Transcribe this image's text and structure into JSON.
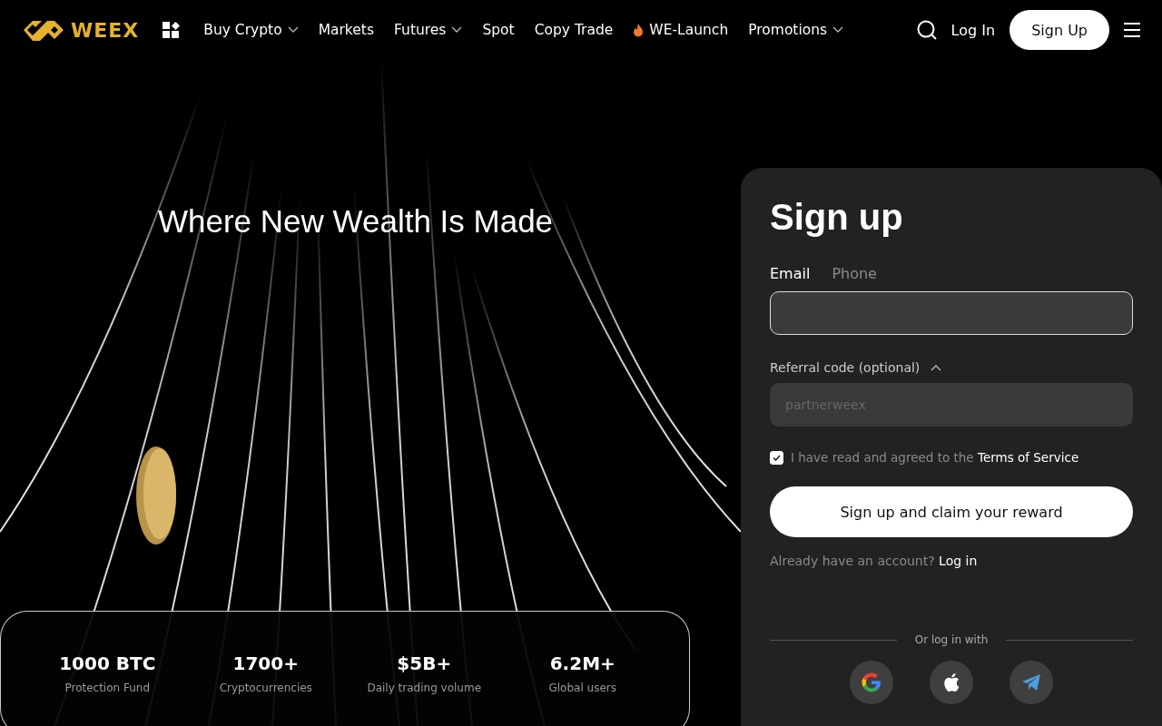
{
  "header": {
    "logo": "WEEX",
    "nav": [
      {
        "label": "Buy Crypto",
        "kind": "dropdown"
      },
      {
        "label": "Markets",
        "kind": "link"
      },
      {
        "label": "Futures",
        "kind": "dropdown"
      },
      {
        "label": "Spot",
        "kind": "link"
      },
      {
        "label": "Copy Trade",
        "kind": "link"
      },
      {
        "label": "WE-Launch",
        "kind": "hot"
      },
      {
        "label": "Promotions",
        "kind": "dropdown"
      }
    ],
    "login": "Log In",
    "signup": "Sign Up"
  },
  "hero": {
    "title": "Where New Wealth Is Made",
    "stats": [
      {
        "value": "1000 BTC",
        "label": "Protection Fund"
      },
      {
        "value": "1700+",
        "label": "Cryptocurrencies"
      },
      {
        "value": "$5B+",
        "label": "Daily trading volume"
      },
      {
        "value": "6.2M+",
        "label": "Global users"
      }
    ]
  },
  "form": {
    "title": "Sign up",
    "tabs": [
      {
        "label": "Email",
        "selected": true
      },
      {
        "label": "Phone",
        "selected": false
      }
    ],
    "referral": {
      "label": "Referral code (optional)",
      "expanded": true,
      "placeholder": "partnerweex"
    },
    "agree": {
      "checked": true,
      "text": "I have read and agreed to the",
      "link": "Terms of Service"
    },
    "submit": "Sign up and claim your reward",
    "account": {
      "text": "Already have an account?",
      "link": "Log in"
    },
    "divider": "Or log in with",
    "socials": [
      {
        "kind": "google"
      },
      {
        "kind": "apple"
      },
      {
        "kind": "telegram"
      }
    ]
  }
}
